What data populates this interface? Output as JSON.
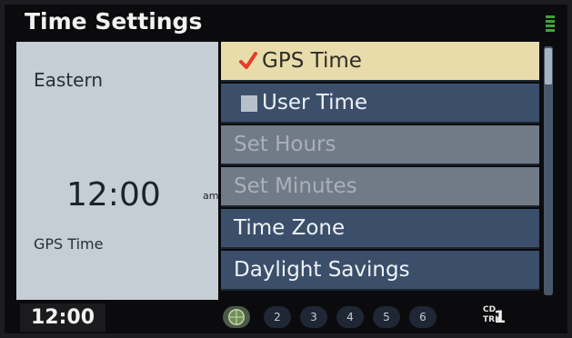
{
  "header": {
    "title": "Time Settings",
    "signal_icon": "signal-strength-icon"
  },
  "left_panel": {
    "zone": "Eastern",
    "clock": "12:00",
    "ampm": "am",
    "mode": "GPS Time"
  },
  "menu": {
    "items": [
      {
        "label": "GPS Time",
        "state": "selected",
        "checked": true,
        "icon": "checkmark-icon"
      },
      {
        "label": "User Time",
        "state": "normal",
        "checked": false,
        "icon": "checkbox-icon"
      },
      {
        "label": "Set Hours",
        "state": "disabled"
      },
      {
        "label": "Set Minutes",
        "state": "disabled"
      },
      {
        "label": "Time Zone",
        "state": "normal"
      },
      {
        "label": "Daylight Savings",
        "state": "normal"
      }
    ]
  },
  "status_bar": {
    "clock": "12:00",
    "presets": [
      "2",
      "3",
      "4",
      "5",
      "6"
    ],
    "media_top": "CD",
    "media_bottom": "TRK",
    "track": "1"
  },
  "colors": {
    "selected_bg": "#e7dcaa",
    "item_bg": "#3b4f6b",
    "disabled_bg": "#717b87",
    "left_panel_bg": "#c5cdd5",
    "check_red": "#e53a2a",
    "signal_green": "#44a040"
  }
}
